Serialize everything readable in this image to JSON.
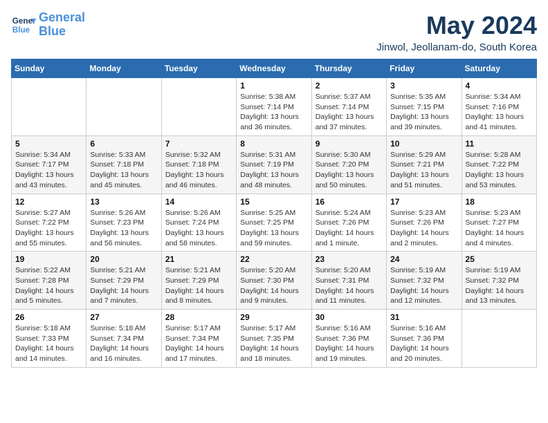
{
  "header": {
    "logo_line1": "General",
    "logo_line2": "Blue",
    "title": "May 2024",
    "subtitle": "Jinwol, Jeollanam-do, South Korea"
  },
  "weekdays": [
    "Sunday",
    "Monday",
    "Tuesday",
    "Wednesday",
    "Thursday",
    "Friday",
    "Saturday"
  ],
  "weeks": [
    [
      {
        "day": "",
        "info": ""
      },
      {
        "day": "",
        "info": ""
      },
      {
        "day": "",
        "info": ""
      },
      {
        "day": "1",
        "info": "Sunrise: 5:38 AM\nSunset: 7:14 PM\nDaylight: 13 hours and 36 minutes."
      },
      {
        "day": "2",
        "info": "Sunrise: 5:37 AM\nSunset: 7:14 PM\nDaylight: 13 hours and 37 minutes."
      },
      {
        "day": "3",
        "info": "Sunrise: 5:35 AM\nSunset: 7:15 PM\nDaylight: 13 hours and 39 minutes."
      },
      {
        "day": "4",
        "info": "Sunrise: 5:34 AM\nSunset: 7:16 PM\nDaylight: 13 hours and 41 minutes."
      }
    ],
    [
      {
        "day": "5",
        "info": "Sunrise: 5:34 AM\nSunset: 7:17 PM\nDaylight: 13 hours and 43 minutes."
      },
      {
        "day": "6",
        "info": "Sunrise: 5:33 AM\nSunset: 7:18 PM\nDaylight: 13 hours and 45 minutes."
      },
      {
        "day": "7",
        "info": "Sunrise: 5:32 AM\nSunset: 7:18 PM\nDaylight: 13 hours and 46 minutes."
      },
      {
        "day": "8",
        "info": "Sunrise: 5:31 AM\nSunset: 7:19 PM\nDaylight: 13 hours and 48 minutes."
      },
      {
        "day": "9",
        "info": "Sunrise: 5:30 AM\nSunset: 7:20 PM\nDaylight: 13 hours and 50 minutes."
      },
      {
        "day": "10",
        "info": "Sunrise: 5:29 AM\nSunset: 7:21 PM\nDaylight: 13 hours and 51 minutes."
      },
      {
        "day": "11",
        "info": "Sunrise: 5:28 AM\nSunset: 7:22 PM\nDaylight: 13 hours and 53 minutes."
      }
    ],
    [
      {
        "day": "12",
        "info": "Sunrise: 5:27 AM\nSunset: 7:22 PM\nDaylight: 13 hours and 55 minutes."
      },
      {
        "day": "13",
        "info": "Sunrise: 5:26 AM\nSunset: 7:23 PM\nDaylight: 13 hours and 56 minutes."
      },
      {
        "day": "14",
        "info": "Sunrise: 5:26 AM\nSunset: 7:24 PM\nDaylight: 13 hours and 58 minutes."
      },
      {
        "day": "15",
        "info": "Sunrise: 5:25 AM\nSunset: 7:25 PM\nDaylight: 13 hours and 59 minutes."
      },
      {
        "day": "16",
        "info": "Sunrise: 5:24 AM\nSunset: 7:26 PM\nDaylight: 14 hours and 1 minute."
      },
      {
        "day": "17",
        "info": "Sunrise: 5:23 AM\nSunset: 7:26 PM\nDaylight: 14 hours and 2 minutes."
      },
      {
        "day": "18",
        "info": "Sunrise: 5:23 AM\nSunset: 7:27 PM\nDaylight: 14 hours and 4 minutes."
      }
    ],
    [
      {
        "day": "19",
        "info": "Sunrise: 5:22 AM\nSunset: 7:28 PM\nDaylight: 14 hours and 5 minutes."
      },
      {
        "day": "20",
        "info": "Sunrise: 5:21 AM\nSunset: 7:29 PM\nDaylight: 14 hours and 7 minutes."
      },
      {
        "day": "21",
        "info": "Sunrise: 5:21 AM\nSunset: 7:29 PM\nDaylight: 14 hours and 8 minutes."
      },
      {
        "day": "22",
        "info": "Sunrise: 5:20 AM\nSunset: 7:30 PM\nDaylight: 14 hours and 9 minutes."
      },
      {
        "day": "23",
        "info": "Sunrise: 5:20 AM\nSunset: 7:31 PM\nDaylight: 14 hours and 11 minutes."
      },
      {
        "day": "24",
        "info": "Sunrise: 5:19 AM\nSunset: 7:32 PM\nDaylight: 14 hours and 12 minutes."
      },
      {
        "day": "25",
        "info": "Sunrise: 5:19 AM\nSunset: 7:32 PM\nDaylight: 14 hours and 13 minutes."
      }
    ],
    [
      {
        "day": "26",
        "info": "Sunrise: 5:18 AM\nSunset: 7:33 PM\nDaylight: 14 hours and 14 minutes."
      },
      {
        "day": "27",
        "info": "Sunrise: 5:18 AM\nSunset: 7:34 PM\nDaylight: 14 hours and 16 minutes."
      },
      {
        "day": "28",
        "info": "Sunrise: 5:17 AM\nSunset: 7:34 PM\nDaylight: 14 hours and 17 minutes."
      },
      {
        "day": "29",
        "info": "Sunrise: 5:17 AM\nSunset: 7:35 PM\nDaylight: 14 hours and 18 minutes."
      },
      {
        "day": "30",
        "info": "Sunrise: 5:16 AM\nSunset: 7:36 PM\nDaylight: 14 hours and 19 minutes."
      },
      {
        "day": "31",
        "info": "Sunrise: 5:16 AM\nSunset: 7:36 PM\nDaylight: 14 hours and 20 minutes."
      },
      {
        "day": "",
        "info": ""
      }
    ]
  ]
}
